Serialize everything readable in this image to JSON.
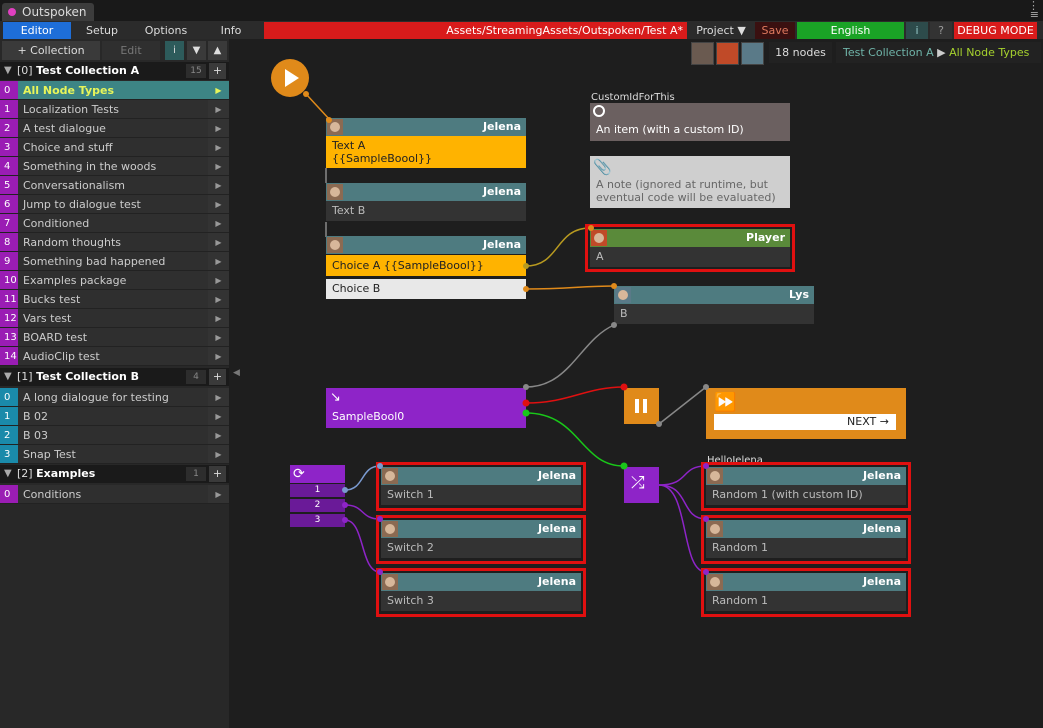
{
  "window": {
    "tab_title": "Outspoken",
    "controls": "⋮\n≡"
  },
  "toolbar": {
    "editor": "Editor",
    "setup": "Setup",
    "options": "Options",
    "info": "Info",
    "path": "Assets/StreamingAssets/Outspoken/Test A*",
    "project": "Project ▼",
    "save": "Save",
    "language": "English",
    "info_btn": "i",
    "help_btn": "?",
    "debug": "DEBUG MODE"
  },
  "sidebar": {
    "collection_btn": "+ Collection",
    "edit_btn": "Edit",
    "info_btn": "i",
    "down_btn": "▼",
    "up_btn": "▲",
    "collections": [
      {
        "index": "[0]",
        "name": "Test Collection A",
        "count": "15",
        "items": [
          {
            "num": "0",
            "label": "All Node Types"
          },
          {
            "num": "1",
            "label": "Localization Tests"
          },
          {
            "num": "2",
            "label": "A test dialogue"
          },
          {
            "num": "3",
            "label": "Choice and stuff"
          },
          {
            "num": "4",
            "label": "Something in the woods"
          },
          {
            "num": "5",
            "label": "Conversationalism"
          },
          {
            "num": "6",
            "label": "Jump to dialogue test"
          },
          {
            "num": "7",
            "label": "Conditioned"
          },
          {
            "num": "8",
            "label": "Random thoughts"
          },
          {
            "num": "9",
            "label": "Something bad happened"
          },
          {
            "num": "10",
            "label": "Examples package"
          },
          {
            "num": "11",
            "label": "Bucks test"
          },
          {
            "num": "12",
            "label": "Vars test"
          },
          {
            "num": "13",
            "label": "BOARD test"
          },
          {
            "num": "14",
            "label": "AudioClip test"
          }
        ]
      },
      {
        "index": "[1]",
        "name": "Test Collection B",
        "count": "4",
        "items": [
          {
            "num": "0",
            "label": "A long dialogue for testing"
          },
          {
            "num": "1",
            "label": "B 02"
          },
          {
            "num": "2",
            "label": "B 03"
          },
          {
            "num": "3",
            "label": "Snap Test"
          }
        ]
      },
      {
        "index": "[2]",
        "name": "Examples",
        "count": "1",
        "items": [
          {
            "num": "0",
            "label": "Conditions"
          }
        ]
      }
    ]
  },
  "header": {
    "node_count": "18 nodes",
    "breadcrumb_collection": "Test Collection A",
    "breadcrumb_sep": "▶",
    "breadcrumb_current": "All Node Types"
  },
  "nodes": {
    "text_a": {
      "speaker": "Jelena",
      "line1": "Text A",
      "line2": "{{SampleBoool}}"
    },
    "text_b": {
      "speaker": "Jelena",
      "text": "Text B"
    },
    "choice": {
      "speaker": "Jelena",
      "option_a": "Choice A {{SampleBoool}}",
      "option_b": "Choice B"
    },
    "player": {
      "speaker": "Player",
      "text": "A"
    },
    "lys": {
      "speaker": "Lys",
      "text": "B"
    },
    "item": {
      "caption": "CustomIdForThis",
      "text": "An item (with a custom ID)"
    },
    "note": {
      "text_line1": "A note (ignored at runtime, but",
      "text_line2": "eventual code will be evaluated)"
    },
    "bool": {
      "label": "SampleBool0"
    },
    "next": {
      "label": "NEXT →"
    },
    "switch": {
      "outputs": [
        "1",
        "2",
        "3"
      ]
    },
    "switch_1": {
      "speaker": "Jelena",
      "text": "Switch 1"
    },
    "switch_2": {
      "speaker": "Jelena",
      "text": "Switch 2"
    },
    "switch_3": {
      "speaker": "Jelena",
      "text": "Switch 3"
    },
    "random_caption": "HelloJelena",
    "random_1": {
      "speaker": "Jelena",
      "text": "Random 1 (with custom ID)"
    },
    "random_2": {
      "speaker": "Jelena",
      "text": "Random 1"
    },
    "random_3": {
      "speaker": "Jelena",
      "text": "Random 1"
    }
  },
  "colors": {
    "accent_blue": "#1e6ed8",
    "debug_red": "#d81b1b",
    "language_green": "#1aa326",
    "speaker_header": "#4e7b80",
    "text_node_yellow": "#ffb300",
    "condition_purple": "#8e24c8",
    "wait_orange": "#e08a1a",
    "connection_green": "#19c719",
    "connection_red": "#e01010"
  }
}
